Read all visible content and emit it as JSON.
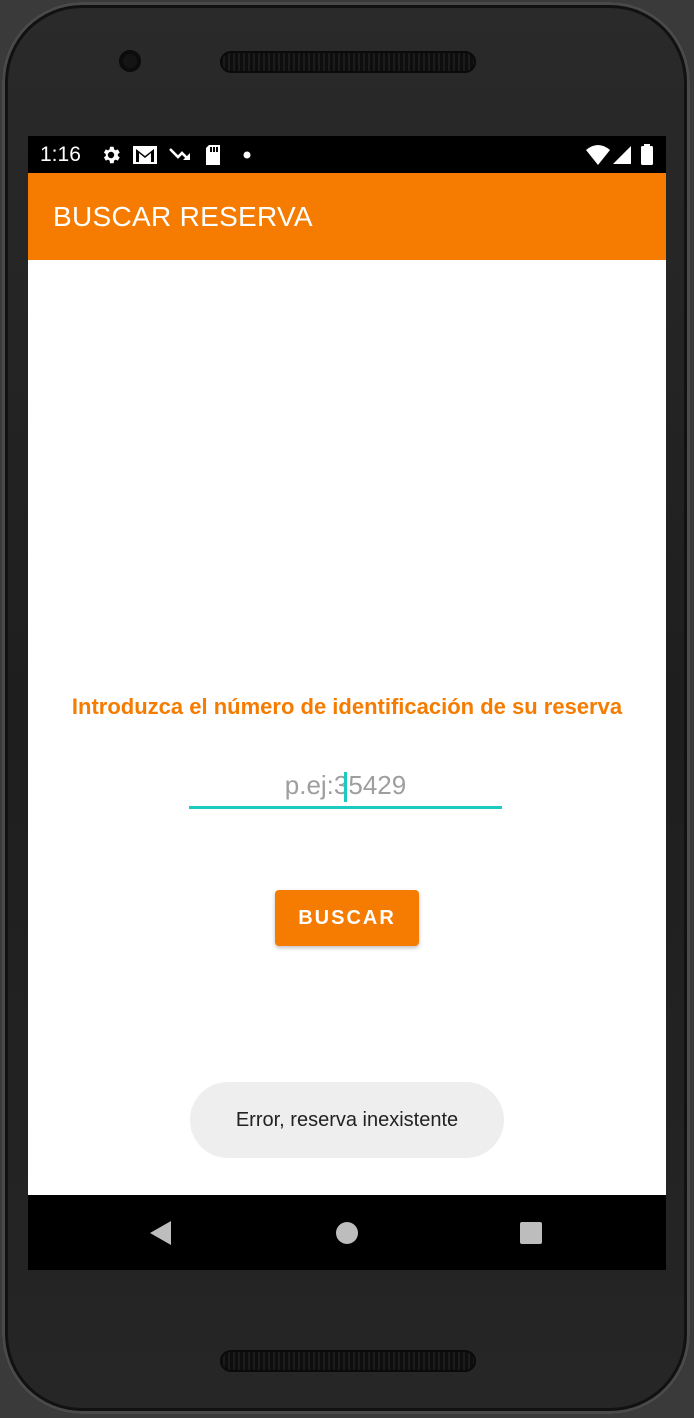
{
  "status_bar": {
    "time": "1:16",
    "left_icons": [
      "gear-icon",
      "gmail-icon",
      "trending-down-icon",
      "sd-card-icon",
      "dot-icon"
    ],
    "right_icons": [
      "wifi-icon",
      "signal-icon",
      "battery-icon"
    ]
  },
  "app_bar": {
    "title": "BUSCAR RESERVA",
    "color": "#f57c00"
  },
  "form": {
    "prompt": "Introduzca el número de identificación de su reserva",
    "input_placeholder": "p.ej:35429",
    "input_value": "",
    "accent_color": "#1ccbbf",
    "button_label": "BUSCAR"
  },
  "toast": {
    "message": "Error, reserva inexistente"
  },
  "nav_bar": {
    "buttons": [
      "back-icon",
      "home-icon",
      "recents-icon"
    ]
  }
}
